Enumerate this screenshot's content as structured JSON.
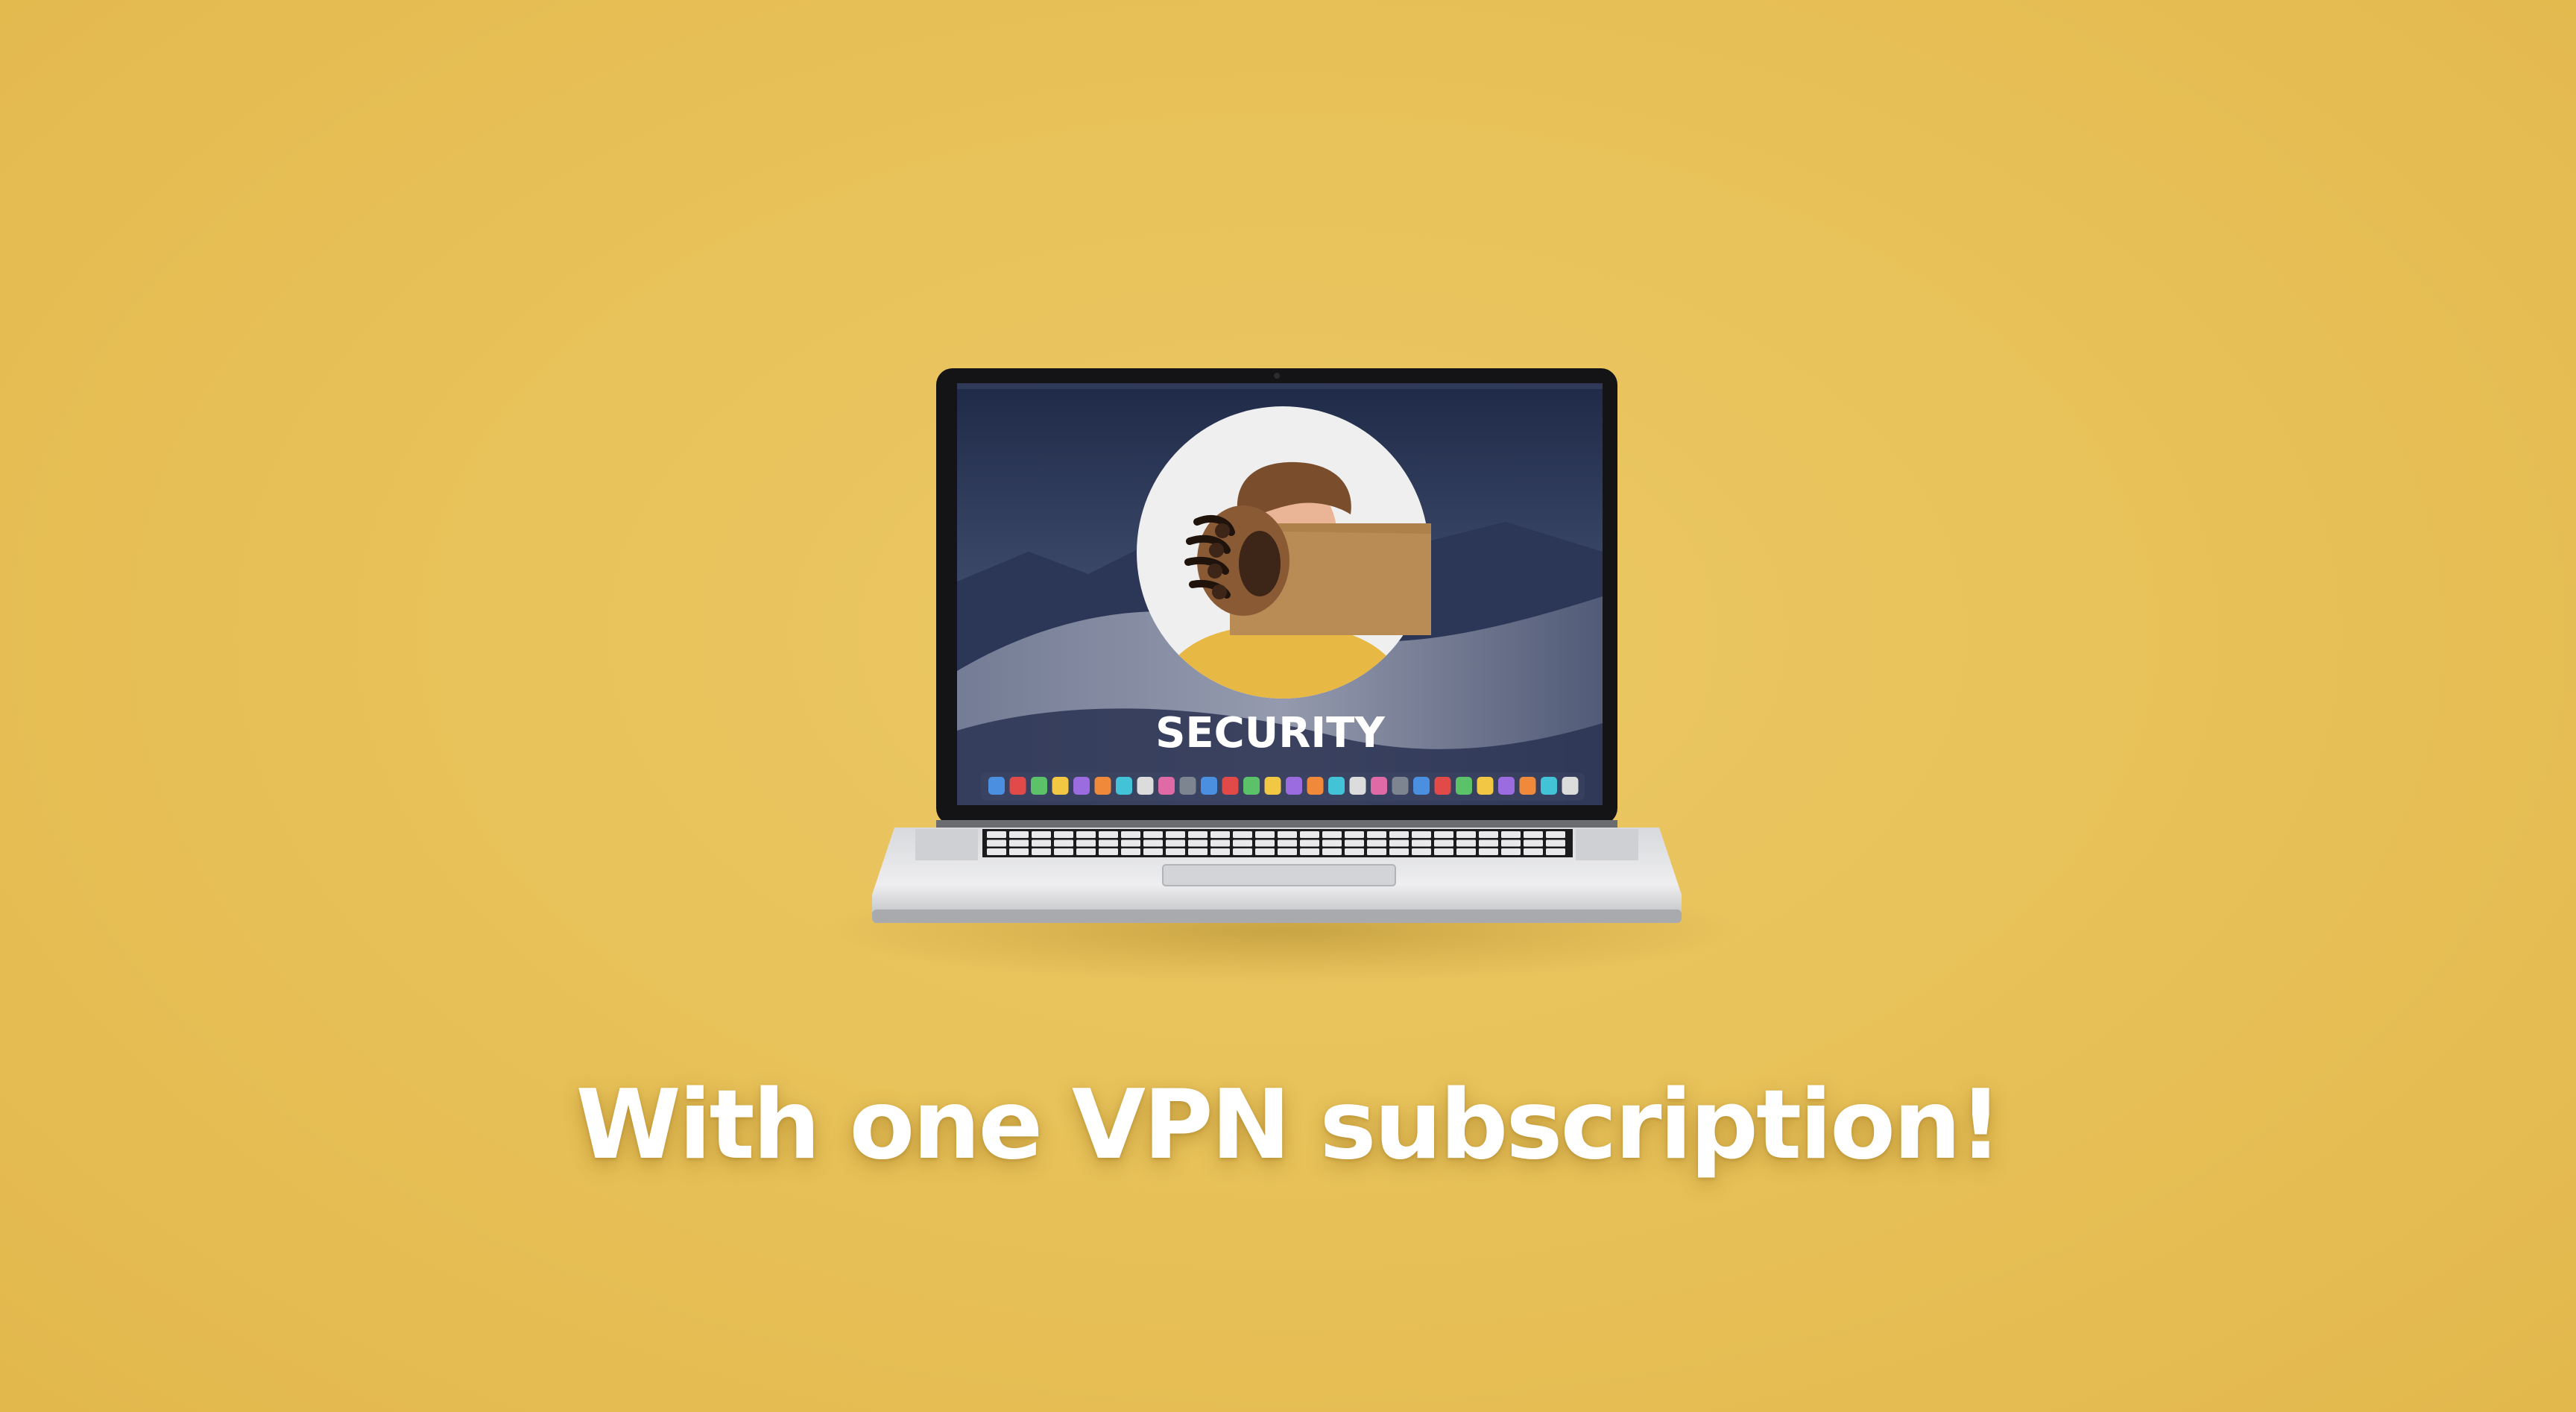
{
  "screen": {
    "label": "SECURITY"
  },
  "caption": {
    "text": "With one VPN subscription!"
  },
  "colors": {
    "background": "#e8c25a",
    "caption": "#ffffff",
    "shirt": "#e8b845",
    "paw": "#8a5a35",
    "paper": "#b98c55"
  },
  "icons": [
    "laptop-icon",
    "person-avatar-icon",
    "bear-paw-icon",
    "dock-icon"
  ]
}
